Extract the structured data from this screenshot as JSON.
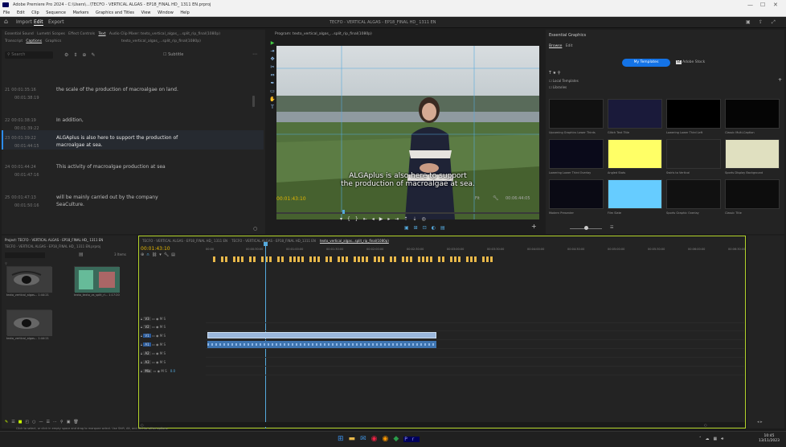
{
  "titlebar": {
    "text": "Adobe Premiere Pro 2024 - C:\\Users\\...\\TECFO - VERTICAL ALGAS - EP18_FINAL HD_ 1311 EN.prproj"
  },
  "menu": [
    "File",
    "Edit",
    "Clip",
    "Sequence",
    "Markers",
    "Graphics and Titles",
    "View",
    "Window",
    "Help"
  ],
  "workspace": {
    "import": "Import",
    "edit": "Edit",
    "export": "Export",
    "title": "TECFO - VERTICAL ALGAS - EP18_FINAL HD_ 1311 EN"
  },
  "text_panel": {
    "tabs": [
      "Essential Sound",
      "Lumetri Scopes",
      "Effect Controls",
      "Text",
      "Audio Clip Mixer: texto_vertical_algas_...split_rip_final(1080p)"
    ],
    "subtabs": [
      "Transcript",
      "Captions",
      "Graphics"
    ],
    "search_placeholder": "Search",
    "track_name": "texto_vertical_algas_...split_rip_final(1080p)",
    "subtitle_label": "Subtitle",
    "captions": [
      {
        "index": "21",
        "in": "00:01:35:16",
        "out": "00:01:38:19",
        "text": "the scale of the production of macroalgae on land."
      },
      {
        "index": "22",
        "in": "00:01:38:19",
        "out": "00:01:39:22",
        "text": "In addition,"
      },
      {
        "index": "23",
        "in": "00:01:39:22",
        "out": "00:01:44:15",
        "text": "ALGAplus is also here to support the production of macroalgae at sea."
      },
      {
        "index": "24",
        "in": "00:01:44:24",
        "out": "00:01:47:16",
        "text": "This activity of macroalgae production at sea"
      },
      {
        "index": "25",
        "in": "00:01:47:13",
        "out": "00:01:50:16",
        "text": "will be mainly carried out by the company SeaCulture."
      }
    ]
  },
  "monitor": {
    "title": "Program: texto_vertical_algas_...split_rip_final(1080p)",
    "caption_line1": "ALGAplus is also here to support",
    "caption_line2": "the production of macroalgae at sea.",
    "timecode_current": "00:01:43:10",
    "timecode_total": "00:06:44:05",
    "zoom": "Fit",
    "quality": "Full"
  },
  "eg": {
    "title": "Essential Graphics",
    "tabs": [
      "Browse",
      "Edit"
    ],
    "buttons": [
      "My Templates",
      "Adobe Stock"
    ],
    "filters": [
      "Local Templates",
      "Libraries"
    ],
    "templates": [
      {
        "name": "Upcoming Graphics Lower Thirds",
        "color": "#111"
      },
      {
        "name": "Glitch Text Title",
        "color": "#1a1a3a"
      },
      {
        "name": "Lowering Lower Third Left",
        "color": "#000"
      },
      {
        "name": "Classic Multi-Caption",
        "color": "#050505"
      },
      {
        "name": "Lowering Lower Third Overlay",
        "color": "#0a0a1a"
      },
      {
        "name": "Angled Stats",
        "color": "#ffff66"
      },
      {
        "name": "Swirls to Vertical",
        "color": "#222"
      },
      {
        "name": "Sports Display Background",
        "color": "#e0e0c0"
      },
      {
        "name": "Modern Presenter",
        "color": "#0a0a14"
      },
      {
        "name": "Film Slate",
        "color": "#66ccff"
      },
      {
        "name": "Sports Graphic Overlay",
        "color": "#111"
      },
      {
        "name": "Classic Title",
        "color": "#0d0d0d"
      }
    ]
  },
  "project": {
    "title": "Project: TECFO - VERTICAL ALGAS - EP18_FINAL HD_ 1311 EN",
    "path": "TECFO - VERTICAL ALGAS - EP18_FINAL HD_ 1311 EN.prproj",
    "count": "3 Items",
    "items": [
      {
        "name": "texto_vertical_algas...",
        "dur": "1:44:21"
      },
      {
        "name": "texto_texto_vs_split_rl...",
        "dur": "1:17:20"
      },
      {
        "name": "texto_vertical_algas...",
        "dur": "1:44:21"
      }
    ]
  },
  "timeline": {
    "tabs": [
      "TECFO - VERTICAL ALGAS - EP18_FINAL HD_ 1311 EN",
      "TECFO - VERTICAL ALGAS - EP18_FINAL HD_1311 EN",
      "texto_vertical_algas...split_rip_final(1080p)"
    ],
    "timecode": "00:01:43:10",
    "ruler": [
      "00:00",
      "00:00:30:00",
      "00:01:00:00",
      "00:01:30:00",
      "00:02:00:00",
      "00:02:30:00",
      "00:03:00:00",
      "00:03:30:00",
      "00:04:00:00",
      "00:04:30:00",
      "00:05:00:00",
      "00:05:30:00",
      "00:06:00:00",
      "00:06:30:00"
    ],
    "tracks": [
      "V3",
      "V2",
      "V1",
      "A1",
      "A2",
      "A3",
      "Mix"
    ],
    "video_clip": "texto_vertical_algas...split_rip_final(1080p).mp4 [V]",
    "mix_value": "0.0"
  },
  "status": "Click to select, or click in empty space and drag to marquee select. Use Shift, Alt, and Ctrl for other options.",
  "clock": {
    "time": "10:45",
    "date": "13/11/2023"
  }
}
